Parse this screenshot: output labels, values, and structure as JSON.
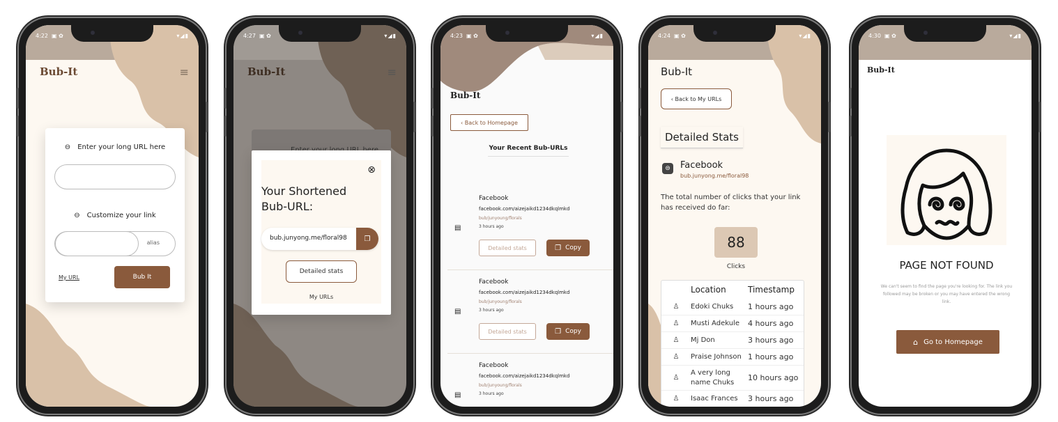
{
  "colors": {
    "accent": "#8a5a3c",
    "cream": "#fdf8f1",
    "beige": "#d7c0a8",
    "tan": "#c8ad93"
  },
  "statusbar": {
    "times": [
      "4:22",
      "4:27",
      "4:23",
      "4:24",
      "4:30"
    ],
    "icons": "▾◢▮"
  },
  "brand": {
    "name": "Bub-It"
  },
  "screen1": {
    "long_url_label": "Enter your long URL here",
    "long_url_value": "",
    "customize_label": "Customize your link",
    "alias_placeholder": "alias",
    "my_url_link": "My URL",
    "submit_button": "Bub It"
  },
  "screen2": {
    "behind_label": "Enter your long URL here",
    "modal_title": "Your Shortened Bub-URL:",
    "short_url": "bub.junyong.me/floral98",
    "detailed_stats_button": "Detailed stats",
    "my_urls_link": "My URLs"
  },
  "screen3": {
    "back_button": "‹ Back to Homepage",
    "heading": "Your Recent Bub-URLs",
    "items": [
      {
        "title": "Facebook",
        "long_url": "facebook.com/aizejaikd1234dkqlmkd",
        "short_url": "bub/junyoung/florals",
        "age": "3 hours ago",
        "stats_button": "Detailed stats",
        "copy_button": "Copy"
      },
      {
        "title": "Facebook",
        "long_url": "facebook.com/aizejaikd1234dkqlmkd",
        "short_url": "bub/junyoung/florals",
        "age": "3 hours ago",
        "stats_button": "Detailed stats",
        "copy_button": "Copy"
      },
      {
        "title": "Facebook",
        "long_url": "facebook.com/aizejaikd1234dkqlmkd",
        "short_url": "bub/junyoung/florals",
        "age": "3 hours ago"
      }
    ]
  },
  "screen4": {
    "back_button": "‹ Back to My URLs",
    "heading": "Detailed Stats",
    "site_name": "Facebook",
    "short_url": "bub.junyong.me/floral98",
    "description": "The total number of clicks that your link has received do far:",
    "click_count": "88",
    "click_label": "Clicks",
    "table_headers": [
      "Location",
      "Timestamp"
    ],
    "rows": [
      {
        "location": "Edoki Chuks",
        "time": "1 hours ago"
      },
      {
        "location": "Musti Adekule",
        "time": "4 hours ago"
      },
      {
        "location": "Mj Don",
        "time": "3 hours ago"
      },
      {
        "location": "Praise Johnson",
        "time": "1 hours ago"
      },
      {
        "location": "A very long name Chuks",
        "time": "10 hours ago"
      },
      {
        "location": "Isaac Frances",
        "time": "3 hours ago"
      }
    ]
  },
  "screen5": {
    "title": "PAGE NOT FOUND",
    "message": "We can't seem to find the page you're looking for. The link you followed may be broken or you may have entered the wrong link.",
    "home_button": "Go to Homepage"
  }
}
